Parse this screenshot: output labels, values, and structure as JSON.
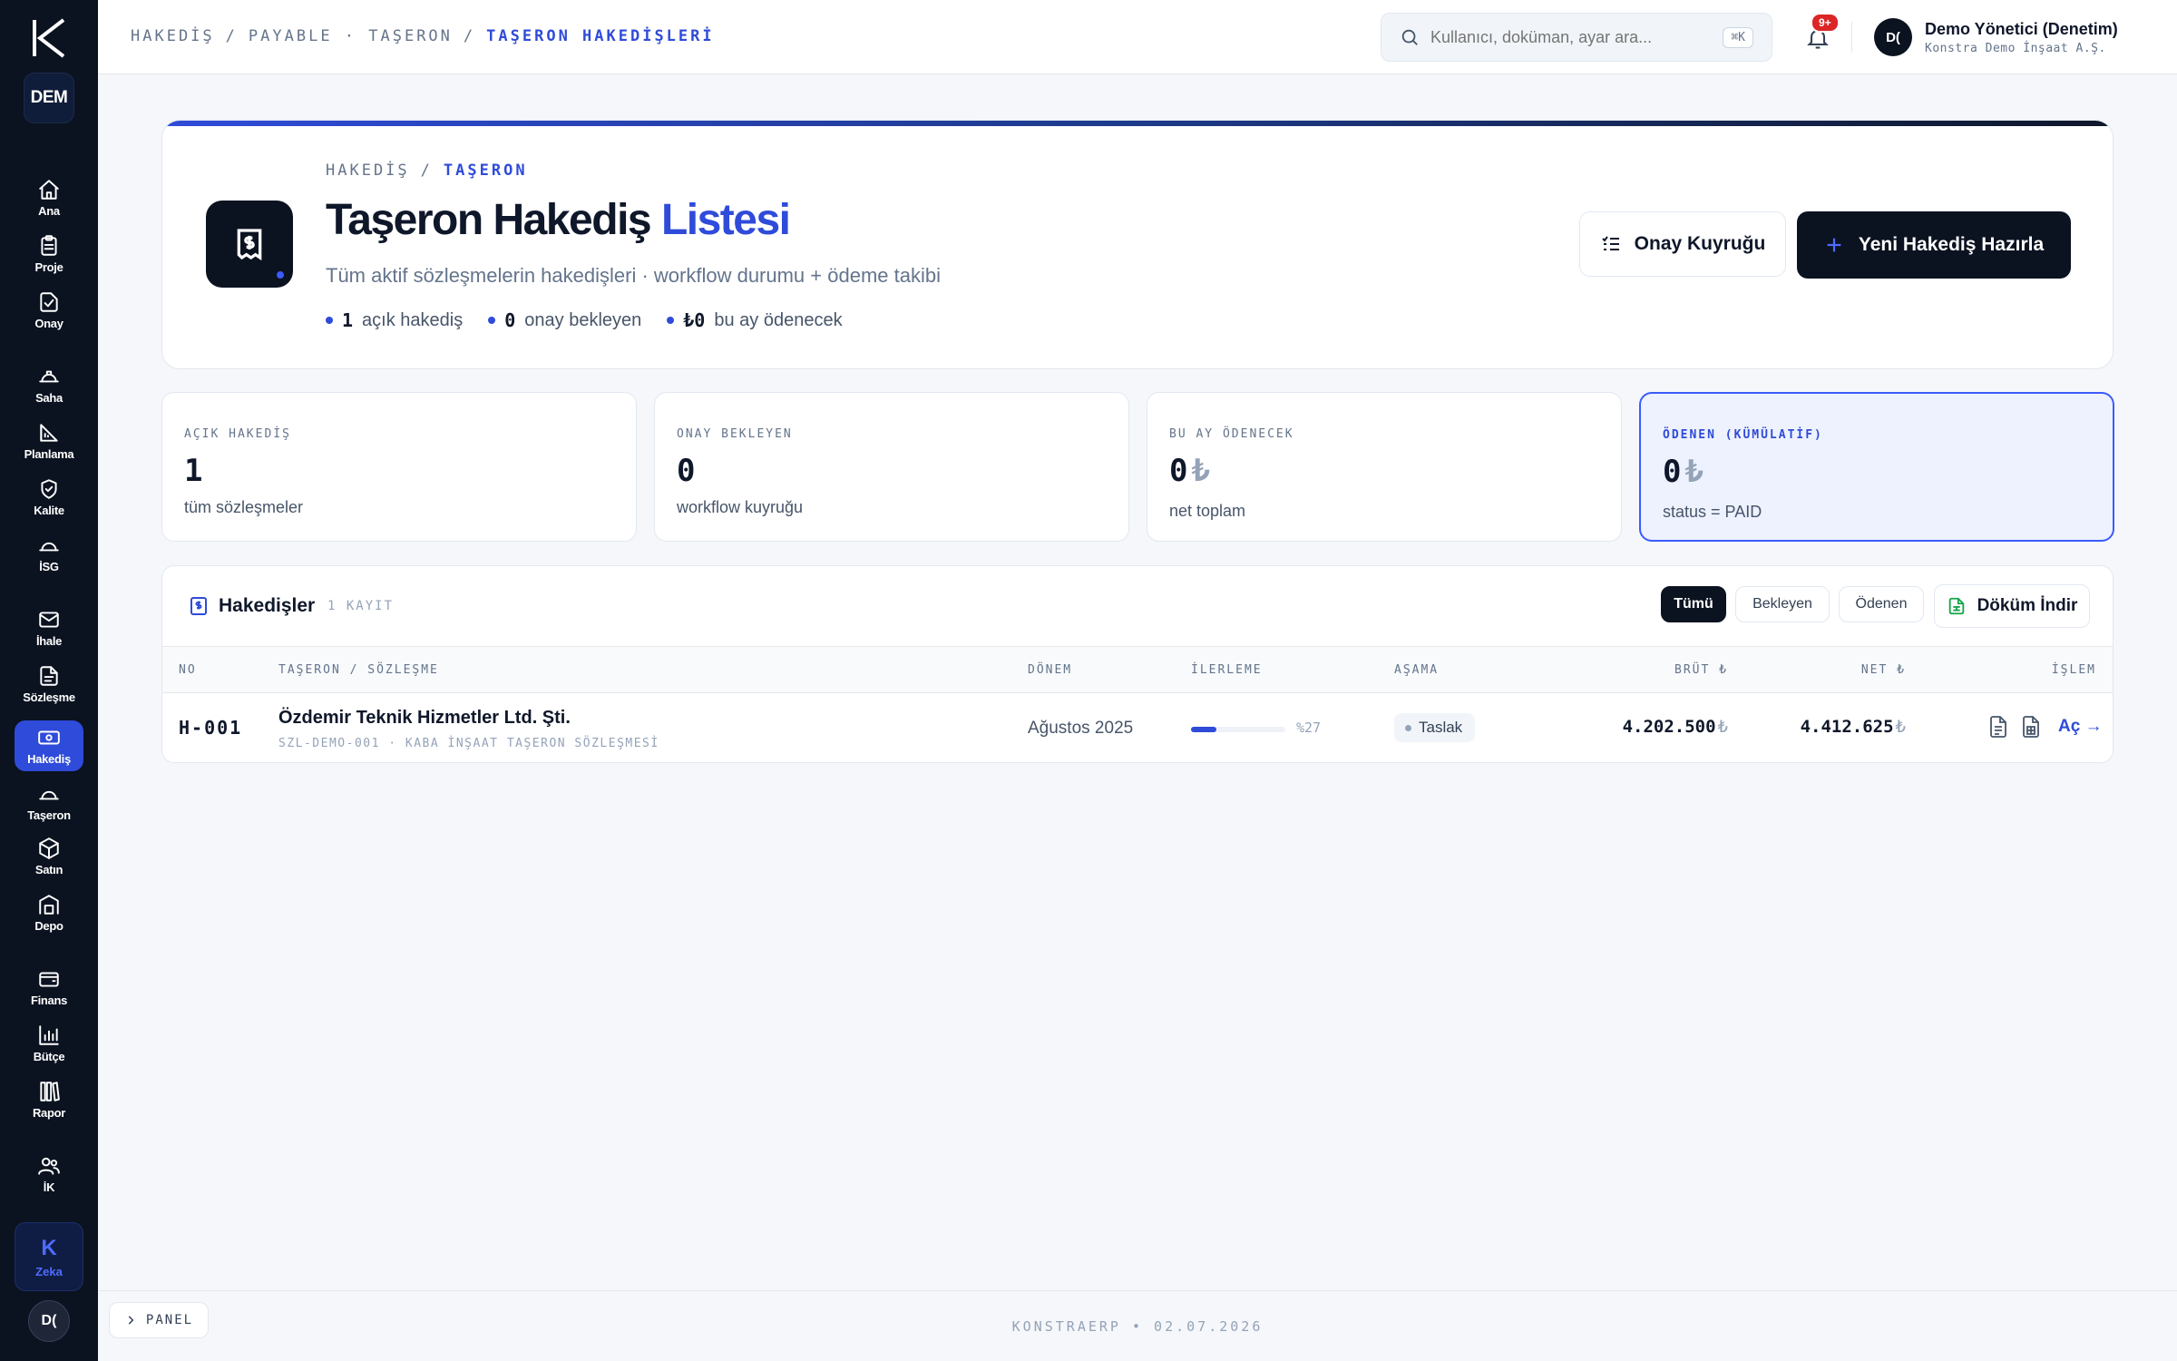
{
  "sidebar": {
    "org_badge": "DEM",
    "items": [
      {
        "label": "Ana",
        "icon": "home-icon"
      },
      {
        "label": "Proje",
        "icon": "clipboard-icon"
      },
      {
        "label": "Onay",
        "icon": "check-square-icon"
      },
      {
        "label": "Saha",
        "icon": "helmet-icon"
      },
      {
        "label": "Planlama",
        "icon": "ruler-icon"
      },
      {
        "label": "Kalite",
        "icon": "shield-check-icon"
      },
      {
        "label": "İSG",
        "icon": "safety-helmet-icon"
      },
      {
        "label": "İhale",
        "icon": "mail-icon"
      },
      {
        "label": "Sözleşme",
        "icon": "document-icon"
      },
      {
        "label": "Hakediş",
        "icon": "banknote-icon",
        "active": true
      },
      {
        "label": "Taşeron",
        "icon": "hardhat-icon"
      },
      {
        "label": "Satın",
        "icon": "box-icon"
      },
      {
        "label": "Depo",
        "icon": "warehouse-icon"
      },
      {
        "label": "Finans",
        "icon": "wallet-icon"
      },
      {
        "label": "Bütçe",
        "icon": "bar-chart-icon"
      },
      {
        "label": "Rapor",
        "icon": "books-icon"
      },
      {
        "label": "İK",
        "icon": "users-icon"
      }
    ],
    "zeka_label": "Zeka",
    "zeka_glyph": "K",
    "avatar": "D("
  },
  "topbar": {
    "breadcrumb": [
      "HAKEDİŞ",
      "/",
      "PAYABLE · TAŞERON",
      "/",
      "TAŞERON HAKEDİŞLERİ"
    ],
    "search_placeholder": "Kullanıcı, doküman, ayar ara...",
    "search_shortcut": "⌘K",
    "notif_count": "9+",
    "user_avatar": "D(",
    "user_name": "Demo Yönetici (Denetim)",
    "user_org": "Konstra Demo İnşaat A.Ş."
  },
  "hero": {
    "crumb_root": "HAKEDİŞ",
    "crumb_sep": "/",
    "crumb_current": "TAŞERON",
    "title_main": "Taşeron Hakediş",
    "title_accent": "Listesi",
    "subtitle": "Tüm aktif sözleşmelerin hakedişleri · workflow durumu + ödeme takibi",
    "stats": [
      {
        "value": "1",
        "label": "açık hakediş"
      },
      {
        "value": "0",
        "label": "onay bekleyen"
      },
      {
        "value": "₺0",
        "label": "bu ay ödenecek"
      }
    ],
    "queue_button": "Onay Kuyruğu",
    "new_button": "Yeni Hakediş Hazırla"
  },
  "kpis": [
    {
      "label": "AÇIK HAKEDİŞ",
      "value": "1",
      "currency": "",
      "sub": "tüm sözleşmeler"
    },
    {
      "label": "ONAY BEKLEYEN",
      "value": "0",
      "currency": "",
      "sub": "workflow kuyruğu"
    },
    {
      "label": "BU AY ÖDENECEK",
      "value": "0",
      "currency": "₺",
      "sub": "net toplam"
    },
    {
      "label": "ÖDENEN (KÜMÜLATİF)",
      "value": "0",
      "currency": "₺",
      "sub": "status = PAID"
    }
  ],
  "table": {
    "title": "Hakedişler",
    "count": "1 KAYIT",
    "filters": [
      "Tümü",
      "Bekleyen",
      "Ödenen"
    ],
    "download_button": "Döküm İndir",
    "columns": {
      "no": "NO",
      "subcontractor": "TAŞERON / SÖZLEŞME",
      "period": "DÖNEM",
      "progress": "İLERLEME",
      "stage": "AŞAMA",
      "gross": "BRÜT ₺",
      "net": "NET ₺",
      "action": "İŞLEM"
    },
    "rows": [
      {
        "no": "H-001",
        "name": "Özdemir Teknik Hizmetler Ltd. Şti.",
        "contract": "SZL-DEMO-001 · KABA İNŞAAT TAŞERON SÖZLEŞMESİ",
        "period": "Ağustos 2025",
        "progress_pct": 27,
        "progress_label": "%27",
        "stage": "Taslak",
        "gross": "4.202.500",
        "net": "4.412.625",
        "currency": "₺",
        "open_label": "Aç →"
      }
    ]
  },
  "footer": {
    "panel_button": "PANEL",
    "text": "KONSTRAERP • 02.07.2026"
  },
  "colors": {
    "accent": "#2f4bd9",
    "sidebar_bg": "#0b1220",
    "badge_red": "#dc2626",
    "download_green": "#16a34a"
  }
}
